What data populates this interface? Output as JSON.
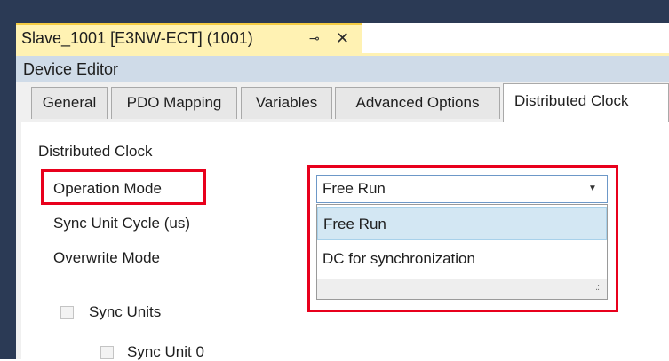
{
  "document_tab": {
    "title": "Slave_1001 [E3NW-ECT] (1001)",
    "pin_glyph": "⊸",
    "close_glyph": "✕"
  },
  "editor": {
    "title": "Device Editor"
  },
  "tabs": [
    {
      "label": "General"
    },
    {
      "label": "PDO Mapping"
    },
    {
      "label": "Variables"
    },
    {
      "label": "Advanced Options"
    },
    {
      "label": "Distributed Clock"
    }
  ],
  "section": {
    "title": "Distributed Clock",
    "operation_mode_label": "Operation Mode",
    "sync_cycle_label": "Sync Unit Cycle (us)",
    "overwrite_label": "Overwrite Mode"
  },
  "operation_mode": {
    "selected": "Free Run",
    "options": [
      "Free Run",
      "DC for synchronization"
    ]
  },
  "sync_units": {
    "label": "Sync Units",
    "unit0_label": "Sync Unit 0"
  },
  "colors": {
    "highlight": "#e8001c",
    "selected_option": "#d3e7f3",
    "header": "#cfdbe8",
    "doc_tab": "#fff2b3"
  }
}
